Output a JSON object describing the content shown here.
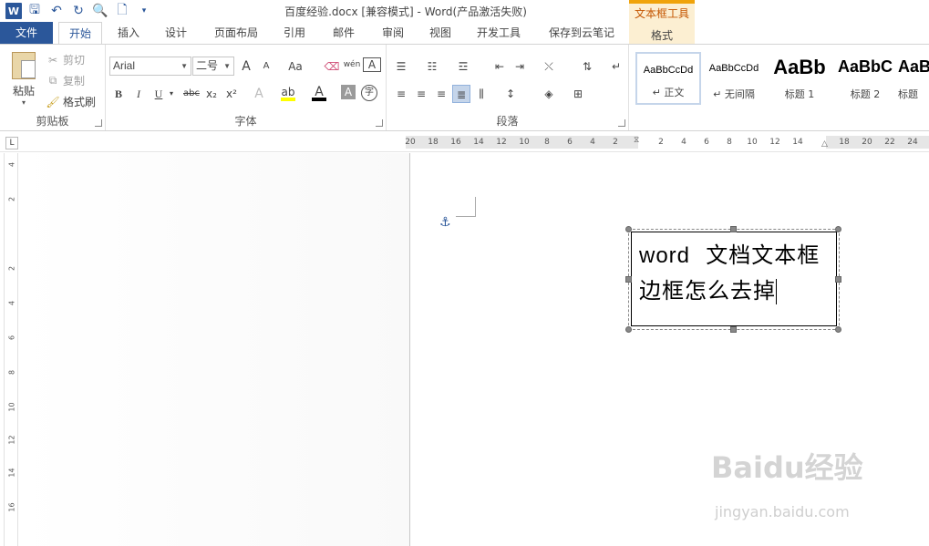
{
  "window": {
    "title": "百度经验.docx [兼容模式] - Word(产品激活失败)"
  },
  "qat": {
    "icons": [
      "word-icon",
      "save-icon",
      "undo-icon",
      "redo-icon",
      "print-preview-icon",
      "new-doc-icon",
      "customize-icon"
    ]
  },
  "contextual": {
    "group_title": "文本框工具",
    "tab_label": "格式"
  },
  "tabs": {
    "file": "文件",
    "items": [
      "开始",
      "插入",
      "设计",
      "页面布局",
      "引用",
      "邮件",
      "审阅",
      "视图",
      "开发工具",
      "保存到云笔记"
    ],
    "active": "开始"
  },
  "ribbon": {
    "clipboard": {
      "label": "剪贴板",
      "paste": "粘贴",
      "cut": "剪切",
      "copy": "复制",
      "format_painter": "格式刷"
    },
    "font": {
      "label": "字体",
      "font_name": "Arial",
      "font_size": "二号",
      "bold": "B",
      "italic": "I",
      "underline": "U",
      "strike": "abc",
      "subscript": "x₂",
      "superscript": "x²",
      "grow": "A",
      "shrink": "A",
      "change_case": "Aa",
      "phonetic": "wén",
      "char_border": "A",
      "text_effect": "A",
      "font_color": "A",
      "char_shading": "A",
      "enclose": "字"
    },
    "paragraph": {
      "label": "段落"
    },
    "styles": {
      "items": [
        {
          "sample": "AaBbCcDd",
          "name": "↵ 正文"
        },
        {
          "sample": "AaBbCcDd",
          "name": "↵ 无间隔"
        },
        {
          "sample": "AaBb",
          "name": "标题 1"
        },
        {
          "sample": "AaBbC",
          "name": "标题 2"
        },
        {
          "sample": "AaB",
          "name": "标题"
        }
      ]
    }
  },
  "ruler": {
    "selector": "L",
    "h_ticks": [
      "20",
      "18",
      "16",
      "14",
      "12",
      "10",
      "8",
      "6",
      "4",
      "2",
      "2",
      "4",
      "6",
      "8",
      "10",
      "12",
      "14",
      "18",
      "20",
      "22",
      "24"
    ],
    "v_ticks": [
      "4",
      "2",
      "2",
      "4",
      "6",
      "8",
      "10",
      "12",
      "14",
      "16"
    ]
  },
  "document": {
    "textbox_line1_en": "word",
    "textbox_line1_cn": "文档文本框",
    "textbox_line2": "边框怎么去掉"
  },
  "watermark": {
    "brand": "Baidu经验",
    "url": "jingyan.baidu.com"
  }
}
